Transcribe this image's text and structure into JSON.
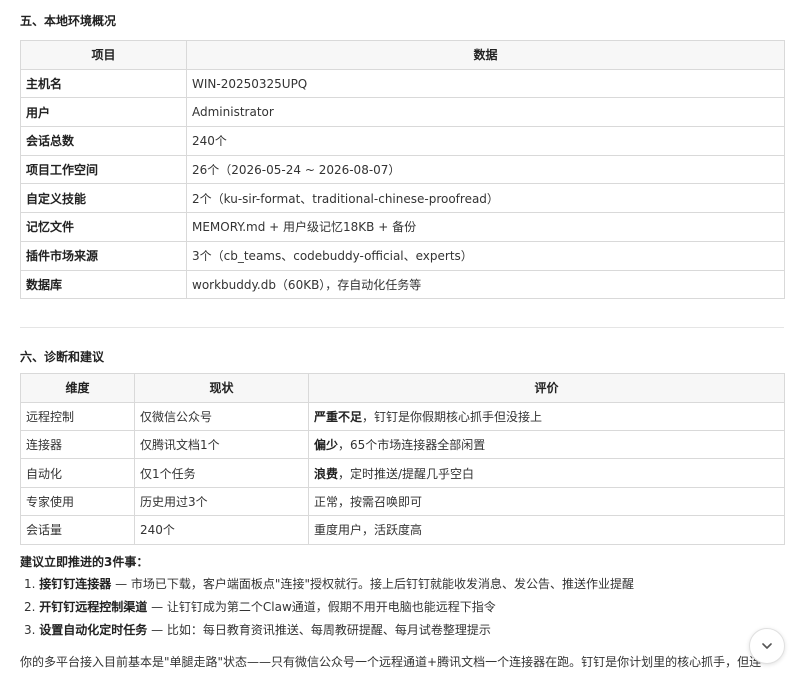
{
  "section5": {
    "title": "五、本地环境概况",
    "headers": [
      "项目",
      "数据"
    ],
    "rows": [
      [
        "主机名",
        "WIN-20250325UPQ"
      ],
      [
        "用户",
        "Administrator"
      ],
      [
        "会话总数",
        "240个"
      ],
      [
        "项目工作空间",
        "26个（2026-05-24 ~ 2026-08-07）"
      ],
      [
        "自定义技能",
        "2个（ku-sir-format、traditional-chinese-proofread）"
      ],
      [
        "记忆文件",
        "MEMORY.md + 用户级记忆18KB + 备份"
      ],
      [
        "插件市场来源",
        "3个（cb_teams、codebuddy-official、experts）"
      ],
      [
        "数据库",
        "workbuddy.db（60KB），存自动化任务等"
      ]
    ]
  },
  "section6": {
    "title": "六、诊断和建议",
    "headers": [
      "维度",
      "现状",
      "评价"
    ],
    "rows": [
      {
        "dim": "远程控制",
        "status": "仅微信公众号",
        "eval_bold": "严重不足",
        "eval_rest": "，钉钉是你假期核心抓手但没接上"
      },
      {
        "dim": "连接器",
        "status": "仅腾讯文档1个",
        "eval_bold": "偏少",
        "eval_rest": "，65个市场连接器全部闲置"
      },
      {
        "dim": "自动化",
        "status": "仅1个任务",
        "eval_bold": "浪费",
        "eval_rest": "，定时推送/提醒几乎空白"
      },
      {
        "dim": "专家使用",
        "status": "历史用过3个",
        "eval_bold": "",
        "eval_rest": "正常，按需召唤即可"
      },
      {
        "dim": "会话量",
        "status": "240个",
        "eval_bold": "",
        "eval_rest": "重度用户，活跃度高"
      }
    ]
  },
  "recommend": {
    "title": "建议立即推进的3件事：",
    "items": [
      {
        "num": "1.",
        "bold": "接钉钉连接器",
        "rest": " — 市场已下载，客户端面板点\"连接\"授权就行。接上后钉钉就能收发消息、发公告、推送作业提醒"
      },
      {
        "num": "2.",
        "bold": "开钉钉远程控制渠道",
        "rest": " — 让钉钉成为第二个Claw通道，假期不用开电脑也能远程下指令"
      },
      {
        "num": "3.",
        "bold": "设置自动化定时任务",
        "rest": " — 比如：每日教育资讯推送、每周教研提醒、每月试卷整理提示"
      }
    ]
  },
  "summary": "你的多平台接入目前基本是\"单腿走路\"状态——只有微信公众号一个远程通道+腾讯文档一个连接器在跑。钉钉是你计划里的核心抓手，但连",
  "icons": {
    "scroll": "chevron-down-icon"
  }
}
